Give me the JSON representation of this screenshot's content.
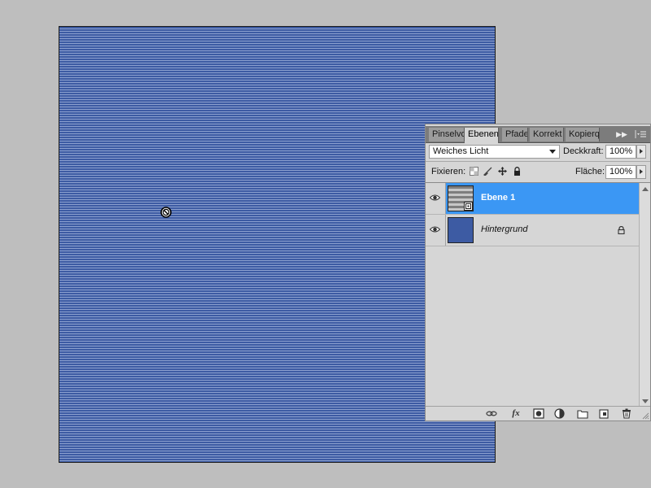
{
  "canvas": {
    "pattern": "blue horizontal stripes",
    "colors": {
      "stripe": "#3d5ba3",
      "gap": "#8ca0cf"
    }
  },
  "cursor": {
    "icon": "not-allowed-cursor-icon"
  },
  "panel": {
    "tabs": [
      {
        "label": "Pinselvo",
        "active": false
      },
      {
        "label": "Ebenen",
        "active": true
      },
      {
        "label": "Pfade",
        "active": false
      },
      {
        "label": "Korrekt",
        "active": false
      },
      {
        "label": "Kopierq",
        "active": false
      }
    ],
    "blend_mode": "Weiches Licht",
    "opacity_label": "Deckkraft:",
    "opacity_value": "100%",
    "lock_label": "Fixieren:",
    "fill_label": "Fläche:",
    "fill_value": "100%",
    "layers": [
      {
        "name": "Ebene 1",
        "selected": true,
        "visible": true,
        "thumb": "striped",
        "smart_object": true
      },
      {
        "name": "Hintergrund",
        "selected": false,
        "visible": true,
        "thumb": "blue",
        "locked": true
      }
    ],
    "selection_color": "#3b97f4",
    "bottom_icons": [
      "link-layers-icon",
      "fx-icon",
      "add-mask-icon",
      "adjustment-layer-icon",
      "new-group-icon",
      "new-layer-icon",
      "trash-icon"
    ],
    "fx_label": "fx"
  }
}
